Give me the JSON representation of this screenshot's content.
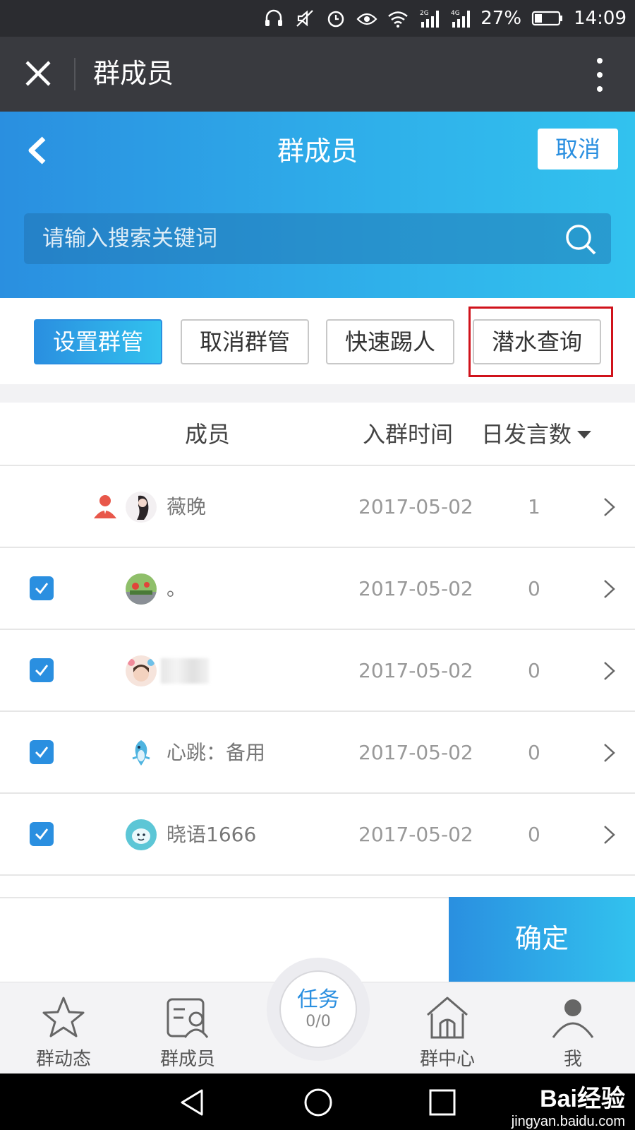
{
  "status_bar": {
    "battery": "27%",
    "time": "14:09",
    "signal_2g": "2G",
    "signal_4g": "4G",
    "icons": [
      "headphones-icon",
      "mute-icon",
      "alarm-icon",
      "eye-icon",
      "wifi-icon",
      "signal-2g-icon",
      "signal-4g-icon",
      "battery-icon"
    ]
  },
  "title_bar": {
    "title": "群成员",
    "close_icon": "close-icon",
    "more_icon": "more-vertical-icon"
  },
  "header": {
    "title": "群成员",
    "cancel_label": "取消",
    "back_icon": "chevron-left-icon",
    "search_placeholder": "请输入搜索关键词",
    "search_icon": "search-icon"
  },
  "actions": {
    "set_admin": "设置群管",
    "cancel_admin": "取消群管",
    "quick_kick": "快速踢人",
    "lurker_query": "潜水查询"
  },
  "table": {
    "headers": {
      "member": "成员",
      "join_time": "入群时间",
      "daily_posts": "日发言数"
    },
    "rows": [
      {
        "name": "薇晚",
        "join_date": "2017-05-02",
        "daily_count": "1",
        "checked": false,
        "owner": true
      },
      {
        "name": "。",
        "join_date": "2017-05-02",
        "daily_count": "0",
        "checked": true,
        "owner": false
      },
      {
        "name": "",
        "join_date": "2017-05-02",
        "daily_count": "0",
        "checked": true,
        "owner": false
      },
      {
        "name": "心跳：备用",
        "join_date": "2017-05-02",
        "daily_count": "0",
        "checked": true,
        "owner": false
      },
      {
        "name": "晓语1666",
        "join_date": "2017-05-02",
        "daily_count": "0",
        "checked": true,
        "owner": false
      }
    ]
  },
  "confirm_label": "确定",
  "tabbar": {
    "tabs": [
      {
        "label": "群动态",
        "icon": "star-icon"
      },
      {
        "label": "群成员",
        "icon": "members-icon"
      },
      {
        "label": "群中心",
        "icon": "house-icon"
      },
      {
        "label": "我",
        "icon": "user-icon"
      }
    ],
    "task_label": "任务",
    "task_count": "0/0"
  },
  "watermark": {
    "logo": "Bai经验",
    "url": "jingyan.baidu.com"
  },
  "colors": {
    "accent": "#2a8fe0",
    "accent_light": "#32c2ee",
    "highlight": "#d0121b",
    "dark_bar": "#393a3f"
  }
}
